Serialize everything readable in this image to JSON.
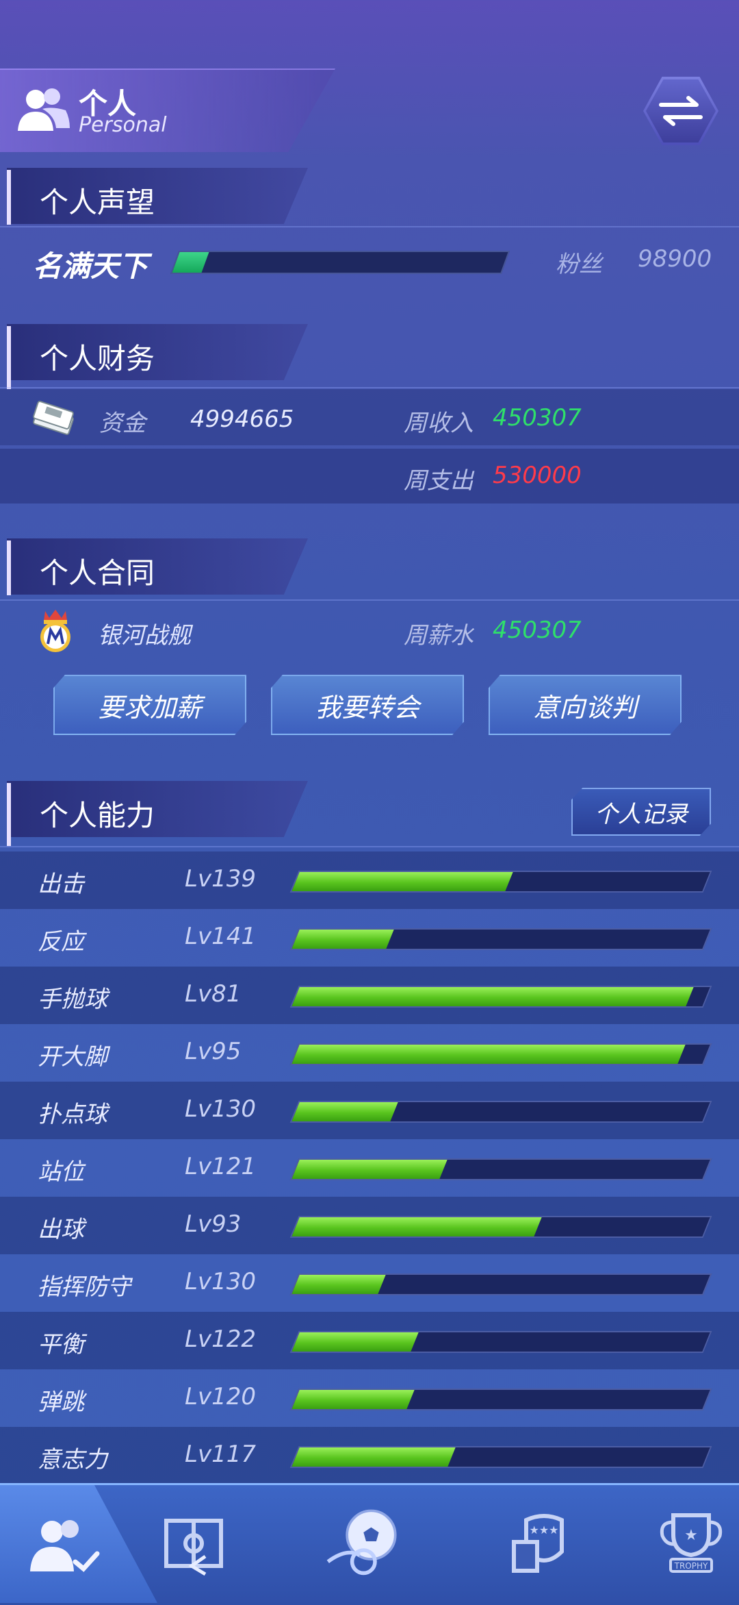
{
  "header": {
    "title": "个人",
    "subtitle": "Personal"
  },
  "reputation": {
    "section_title": "个人声望",
    "level_name": "名满天下",
    "progress": 0.09,
    "fans_label": "粉丝",
    "fans_value": "98900"
  },
  "finance": {
    "section_title": "个人财务",
    "funds_label": "资金",
    "funds_value": "4994665",
    "weekly_income_label": "周收入",
    "weekly_income_value": "450307",
    "weekly_expense_label": "周支出",
    "weekly_expense_value": "530000"
  },
  "contract": {
    "section_title": "个人合同",
    "club_name": "银河战舰",
    "weekly_salary_label": "周薪水",
    "weekly_salary_value": "450307",
    "buttons": [
      "要求加薪",
      "我要转会",
      "意向谈判"
    ]
  },
  "ability": {
    "section_title": "个人能力",
    "records_button": "个人记录",
    "items": [
      {
        "name": "出击",
        "level": "Lv139",
        "progress": 0.52
      },
      {
        "name": "反应",
        "level": "Lv141",
        "progress": 0.23
      },
      {
        "name": "手抛球",
        "level": "Lv81",
        "progress": 0.96
      },
      {
        "name": "开大脚",
        "level": "Lv95",
        "progress": 0.94
      },
      {
        "name": "扑点球",
        "level": "Lv130",
        "progress": 0.24
      },
      {
        "name": "站位",
        "level": "Lv121",
        "progress": 0.36
      },
      {
        "name": "出球",
        "level": "Lv93",
        "progress": 0.59
      },
      {
        "name": "指挥防守",
        "level": "Lv130",
        "progress": 0.21
      },
      {
        "name": "平衡",
        "level": "Lv122",
        "progress": 0.29
      },
      {
        "name": "弹跳",
        "level": "Lv120",
        "progress": 0.28
      },
      {
        "name": "意志力",
        "level": "Lv117",
        "progress": 0.38
      }
    ]
  },
  "nav": {
    "items": [
      "personal-icon",
      "tactics-field-icon",
      "match-ball-icon",
      "club-card-icon",
      "trophy-icon"
    ],
    "trophy_text": "TROPHY",
    "active_index": 0
  },
  "colors": {
    "income_green": "#2fe06a",
    "expense_red": "#ff3b4a",
    "bar_green": "#59c41e"
  }
}
